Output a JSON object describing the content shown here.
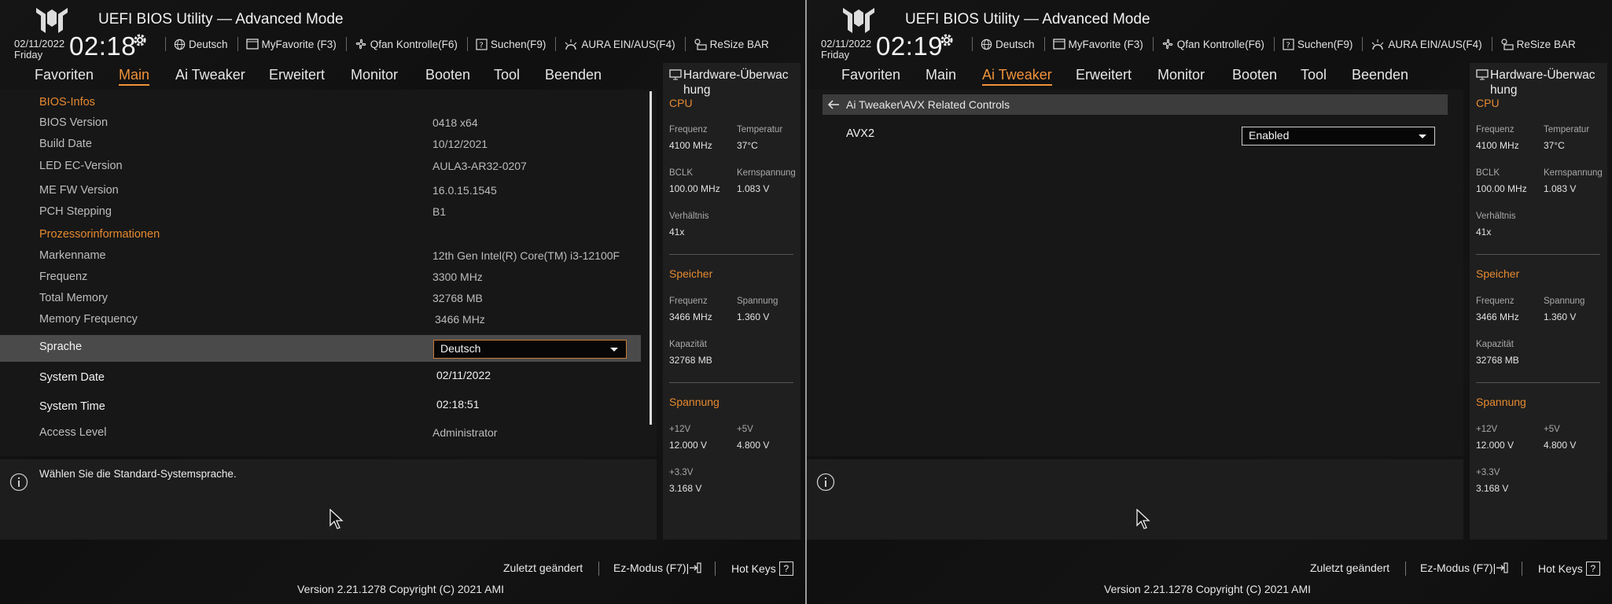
{
  "panels": [
    {
      "app_title": "UEFI BIOS Utility — Advanced Mode",
      "date": "02/11/2022",
      "weekday": "Friday",
      "time": "02:18",
      "toolbar": [
        "Deutsch",
        "MyFavorite (F3)",
        "Qfan Kontrolle(F6)",
        "Suchen(F9)",
        "AURA EIN/AUS(F4)",
        "ReSize BAR"
      ],
      "menu": [
        "Favoriten",
        "Main",
        "Ai Tweaker",
        "Erweitert",
        "Monitor",
        "Booten",
        "Tool",
        "Beenden"
      ],
      "active_menu": "Main",
      "bios_info": {
        "section_title": "BIOS-Infos",
        "rows": [
          {
            "label": "BIOS Version",
            "value": "0418  x64"
          },
          {
            "label": "Build Date",
            "value": "10/12/2021"
          },
          {
            "label": "LED EC-Version",
            "value": "AULA3-AR32-0207"
          },
          {
            "label": "ME FW Version",
            "value": "16.0.15.1545"
          },
          {
            "label": "PCH Stepping",
            "value": "B1"
          }
        ]
      },
      "processor_info": {
        "section_title": "Prozessorinformationen",
        "rows": [
          {
            "label": "Markenname",
            "value": "12th Gen Intel(R) Core(TM) i3-12100F"
          },
          {
            "label": "Frequenz",
            "value": "3300 MHz"
          },
          {
            "label": "Total Memory",
            "value": "32768 MB"
          },
          {
            "label": "Memory Frequency",
            "value": "3466 MHz"
          }
        ]
      },
      "settings": {
        "language_label": "Sprache",
        "language_value": "Deutsch",
        "system_date_label": "System Date",
        "system_date_value": "02/11/2022",
        "system_time_label": "System Time",
        "system_time_value": "02:18:51",
        "access_level_label": "Access Level",
        "access_level_value": "Administrator"
      },
      "help_text": "Wählen Sie die Standard-Systemsprache."
    },
    {
      "app_title": "UEFI BIOS Utility — Advanced Mode",
      "date": "02/11/2022",
      "weekday": "Friday",
      "time": "02:19",
      "toolbar": [
        "Deutsch",
        "MyFavorite (F3)",
        "Qfan Kontrolle(F6)",
        "Suchen(F9)",
        "AURA EIN/AUS(F4)",
        "ReSize BAR"
      ],
      "menu": [
        "Favoriten",
        "Main",
        "Ai Tweaker",
        "Erweitert",
        "Monitor",
        "Booten",
        "Tool",
        "Beenden"
      ],
      "active_menu": "Ai Tweaker",
      "breadcrumb": "Ai Tweaker\\AVX Related Controls",
      "avx2_label": "AVX2",
      "avx2_value": "Enabled",
      "help_text": ""
    }
  ],
  "hardware_monitor": {
    "title": "Hardware-Überwachung",
    "title_line1": "Hardware-Überwac",
    "title_line2": "hung",
    "cpu": {
      "title": "CPU",
      "frequency_label": "Frequenz",
      "frequency": "4100 MHz",
      "temperature_label": "Temperatur",
      "temperature": "37°C",
      "bclk_label": "BCLK",
      "bclk": "100.00 MHz",
      "core_voltage_label": "Kernspannung",
      "core_voltage": "1.083 V",
      "ratio_label": "Verhältnis",
      "ratio": "41x"
    },
    "memory": {
      "title": "Speicher",
      "frequency_label": "Frequenz",
      "frequency": "3466 MHz",
      "voltage_label": "Spannung",
      "voltage": "1.360 V",
      "capacity_label": "Kapazität",
      "capacity": "32768 MB"
    },
    "voltage": {
      "title": "Spannung",
      "v12_label": "+12V",
      "v12": "12.000 V",
      "v5_label": "+5V",
      "v5": "4.800 V",
      "v33_label": "+3.3V",
      "v33": "3.168 V"
    }
  },
  "footer": {
    "last_modified": "Zuletzt geändert",
    "ez_mode": "Ez-Modus (F7)|",
    "hot_keys": "Hot Keys",
    "hot_keys_icon": "?",
    "version": "Version 2.21.1278 Copyright (C) 2021 AMI"
  },
  "colors": {
    "accent": "#e78a30",
    "highlight_row": "#4a4a4a",
    "panel_bg": "#171717"
  },
  "icons": [
    "tuf-logo-icon",
    "gear-icon",
    "globe-icon",
    "myfavorite-icon",
    "fan-icon",
    "search-icon",
    "aura-icon",
    "resize-bar-icon",
    "monitor-icon",
    "info-icon",
    "back-arrow-icon",
    "exit-icon",
    "mouse-cursor-icon"
  ]
}
